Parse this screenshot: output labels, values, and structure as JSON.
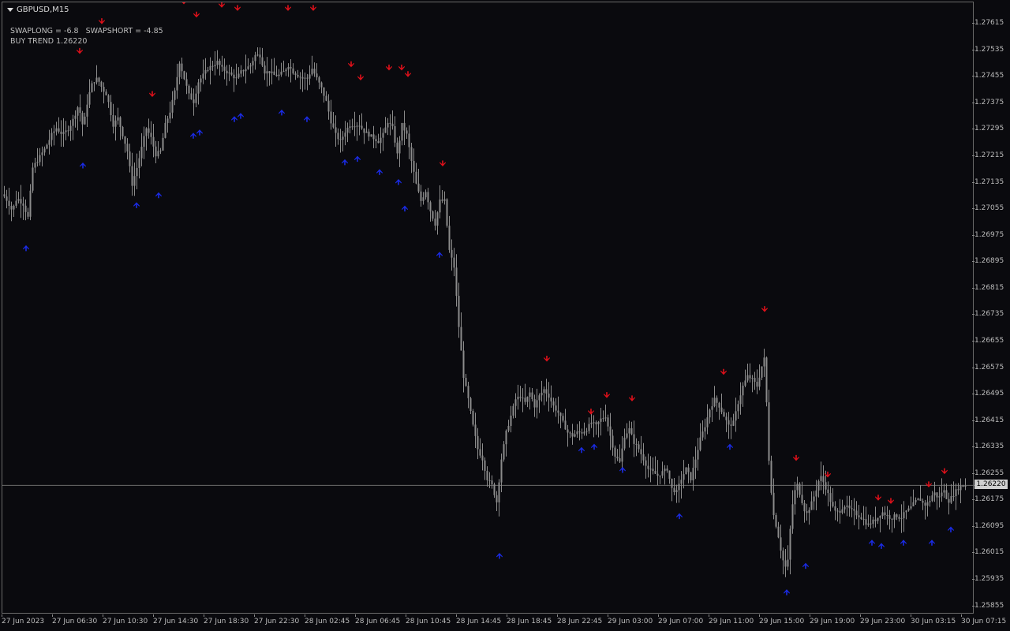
{
  "symbol": {
    "label": "GBPUSD,M15"
  },
  "indicator": {
    "swap_line": "SWAPLONG = -6.8   SWAPSHORT = -4.85",
    "trend_line": "BUY TREND 1.26220"
  },
  "price_axis": {
    "labels": [
      "1.27615",
      "1.27535",
      "1.27455",
      "1.27375",
      "1.27295",
      "1.27215",
      "1.27135",
      "1.27055",
      "1.26975",
      "1.26895",
      "1.26815",
      "1.26735",
      "1.26655",
      "1.26575",
      "1.26495",
      "1.26415",
      "1.26335",
      "1.26255",
      "1.26175",
      "1.26095",
      "1.26015",
      "1.25935",
      "1.25855"
    ]
  },
  "current_price": {
    "label": "1.26220",
    "value": 1.2622
  },
  "time_axis": {
    "labels": [
      "27 Jun 2023",
      "27 Jun 06:30",
      "27 Jun 10:30",
      "27 Jun 14:30",
      "27 Jun 18:30",
      "27 Jun 22:30",
      "28 Jun 02:45",
      "28 Jun 06:45",
      "28 Jun 10:45",
      "28 Jun 14:45",
      "28 Jun 18:45",
      "28 Jun 22:45",
      "29 Jun 03:00",
      "29 Jun 07:00",
      "29 Jun 11:00",
      "29 Jun 15:00",
      "29 Jun 19:00",
      "29 Jun 23:00",
      "30 Jun 03:15",
      "30 Jun 07:15"
    ]
  },
  "colors": {
    "background": "#0a0a0e",
    "candle": "#8c8c8c",
    "sell_arrow": "#e0101a",
    "buy_arrow": "#1a2be6",
    "grid_line": "#6a6a6a"
  },
  "chart_data": {
    "type": "candlestick",
    "symbol": "GBPUSD",
    "timeframe": "M15",
    "y_range": [
      1.2583,
      1.2768
    ],
    "path": [
      [
        0,
        1.271
      ],
      [
        6,
        1.2708
      ],
      [
        12,
        1.2705
      ],
      [
        18,
        1.2709
      ],
      [
        26,
        1.2707
      ],
      [
        32,
        1.2703
      ],
      [
        38,
        1.2718
      ],
      [
        46,
        1.2721
      ],
      [
        54,
        1.2724
      ],
      [
        62,
        1.2728
      ],
      [
        68,
        1.273
      ],
      [
        76,
        1.2728
      ],
      [
        84,
        1.273
      ],
      [
        90,
        1.2733
      ],
      [
        96,
        1.2737
      ],
      [
        102,
        1.273
      ],
      [
        108,
        1.2739
      ],
      [
        114,
        1.2744
      ],
      [
        120,
        1.2745
      ],
      [
        126,
        1.2742
      ],
      [
        132,
        1.274
      ],
      [
        140,
        1.2731
      ],
      [
        146,
        1.2733
      ],
      [
        152,
        1.2728
      ],
      [
        158,
        1.2723
      ],
      [
        164,
        1.2713
      ],
      [
        170,
        1.2718
      ],
      [
        176,
        1.2724
      ],
      [
        182,
        1.273
      ],
      [
        188,
        1.2727
      ],
      [
        194,
        1.2722
      ],
      [
        200,
        1.2723
      ],
      [
        206,
        1.2731
      ],
      [
        212,
        1.2735
      ],
      [
        218,
        1.2741
      ],
      [
        224,
        1.275
      ],
      [
        230,
        1.2745
      ],
      [
        236,
        1.274
      ],
      [
        242,
        1.2738
      ],
      [
        248,
        1.2744
      ],
      [
        254,
        1.2746
      ],
      [
        260,
        1.2748
      ],
      [
        266,
        1.2749
      ],
      [
        272,
        1.275
      ],
      [
        278,
        1.2748
      ],
      [
        284,
        1.2747
      ],
      [
        290,
        1.2746
      ],
      [
        296,
        1.2745
      ],
      [
        302,
        1.2747
      ],
      [
        308,
        1.2748
      ],
      [
        314,
        1.2749
      ],
      [
        320,
        1.2752
      ],
      [
        326,
        1.2752
      ],
      [
        332,
        1.2747
      ],
      [
        338,
        1.2747
      ],
      [
        344,
        1.2746
      ],
      [
        350,
        1.2746
      ],
      [
        356,
        1.2747
      ],
      [
        362,
        1.2749
      ],
      [
        368,
        1.2747
      ],
      [
        374,
        1.2746
      ],
      [
        380,
        1.2745
      ],
      [
        386,
        1.2745
      ],
      [
        392,
        1.2748
      ],
      [
        398,
        1.2745
      ],
      [
        404,
        1.2742
      ],
      [
        410,
        1.2738
      ],
      [
        416,
        1.2732
      ],
      [
        422,
        1.2728
      ],
      [
        428,
        1.2726
      ],
      [
        434,
        1.2729
      ],
      [
        440,
        1.2731
      ],
      [
        446,
        1.2731
      ],
      [
        452,
        1.2731
      ],
      [
        458,
        1.2729
      ],
      [
        464,
        1.2728
      ],
      [
        470,
        1.2727
      ],
      [
        476,
        1.2726
      ],
      [
        482,
        1.2728
      ],
      [
        488,
        1.2732
      ],
      [
        494,
        1.273
      ],
      [
        500,
        1.2722
      ],
      [
        506,
        1.2731
      ],
      [
        512,
        1.2728
      ],
      [
        518,
        1.272
      ],
      [
        524,
        1.2713
      ],
      [
        530,
        1.2708
      ],
      [
        536,
        1.2711
      ],
      [
        542,
        1.2705
      ],
      [
        548,
        1.2701
      ],
      [
        554,
        1.2708
      ],
      [
        560,
        1.2708
      ],
      [
        566,
        1.2693
      ],
      [
        572,
        1.2688
      ],
      [
        578,
        1.267
      ],
      [
        584,
        1.2655
      ],
      [
        590,
        1.2648
      ],
      [
        596,
        1.264
      ],
      [
        602,
        1.2633
      ],
      [
        608,
        1.263
      ],
      [
        614,
        1.2624
      ],
      [
        620,
        1.2622
      ],
      [
        626,
        1.2617
      ],
      [
        632,
        1.263
      ],
      [
        638,
        1.2638
      ],
      [
        644,
        1.2643
      ],
      [
        650,
        1.2648
      ],
      [
        656,
        1.2649
      ],
      [
        662,
        1.2647
      ],
      [
        668,
        1.265
      ],
      [
        674,
        1.2646
      ],
      [
        680,
        1.2649
      ],
      [
        686,
        1.2651
      ],
      [
        692,
        1.2649
      ],
      [
        698,
        1.2646
      ],
      [
        704,
        1.2644
      ],
      [
        710,
        1.2641
      ],
      [
        716,
        1.2638
      ],
      [
        722,
        1.2637
      ],
      [
        728,
        1.2638
      ],
      [
        734,
        1.2638
      ],
      [
        740,
        1.2639
      ],
      [
        746,
        1.2641
      ],
      [
        752,
        1.264
      ],
      [
        758,
        1.2642
      ],
      [
        764,
        1.2643
      ],
      [
        770,
        1.2637
      ],
      [
        776,
        1.2631
      ],
      [
        782,
        1.2629
      ],
      [
        788,
        1.2637
      ],
      [
        794,
        1.2639
      ],
      [
        800,
        1.2635
      ],
      [
        806,
        1.2633
      ],
      [
        812,
        1.263
      ],
      [
        818,
        1.2627
      ],
      [
        824,
        1.2626
      ],
      [
        830,
        1.2625
      ],
      [
        836,
        1.2626
      ],
      [
        842,
        1.2627
      ],
      [
        848,
        1.2621
      ],
      [
        854,
        1.262
      ],
      [
        860,
        1.2624
      ],
      [
        866,
        1.2627
      ],
      [
        872,
        1.2624
      ],
      [
        878,
        1.263
      ],
      [
        884,
        1.2636
      ],
      [
        890,
        1.264
      ],
      [
        896,
        1.2645
      ],
      [
        902,
        1.2648
      ],
      [
        908,
        1.2646
      ],
      [
        914,
        1.2643
      ],
      [
        920,
        1.264
      ],
      [
        926,
        1.2641
      ],
      [
        932,
        1.2647
      ],
      [
        938,
        1.2652
      ],
      [
        944,
        1.2655
      ],
      [
        950,
        1.2654
      ],
      [
        956,
        1.2652
      ],
      [
        962,
        1.2658
      ],
      [
        966,
        1.2661
      ],
      [
        970,
        1.2633
      ],
      [
        976,
        1.2614
      ],
      [
        982,
        1.2608
      ],
      [
        988,
        1.26
      ],
      [
        994,
        1.2596
      ],
      [
        1000,
        1.2615
      ],
      [
        1006,
        1.2623
      ],
      [
        1012,
        1.2618
      ],
      [
        1018,
        1.2613
      ],
      [
        1024,
        1.2616
      ],
      [
        1030,
        1.262
      ],
      [
        1036,
        1.2625
      ],
      [
        1042,
        1.2622
      ],
      [
        1048,
        1.2618
      ],
      [
        1054,
        1.2614
      ],
      [
        1060,
        1.2614
      ],
      [
        1066,
        1.2616
      ],
      [
        1072,
        1.2615
      ],
      [
        1078,
        1.2614
      ],
      [
        1084,
        1.2613
      ],
      [
        1090,
        1.2612
      ],
      [
        1096,
        1.261
      ],
      [
        1102,
        1.2611
      ],
      [
        1108,
        1.2612
      ],
      [
        1114,
        1.2614
      ],
      [
        1120,
        1.2613
      ],
      [
        1126,
        1.2612
      ],
      [
        1132,
        1.2613
      ],
      [
        1138,
        1.2612
      ],
      [
        1144,
        1.2614
      ],
      [
        1150,
        1.2615
      ],
      [
        1156,
        1.2617
      ],
      [
        1162,
        1.2618
      ],
      [
        1168,
        1.2616
      ],
      [
        1174,
        1.2617
      ],
      [
        1180,
        1.262
      ],
      [
        1186,
        1.2618
      ],
      [
        1192,
        1.2621
      ],
      [
        1198,
        1.2617
      ],
      [
        1204,
        1.2619
      ],
      [
        1210,
        1.2621
      ],
      [
        1216,
        1.2622
      ],
      [
        1222,
        1.2622
      ]
    ],
    "sell_arrows": [
      [
        98,
        1.2753
      ],
      [
        126,
        1.2762
      ],
      [
        190,
        1.274
      ],
      [
        230,
        1.2768
      ],
      [
        246,
        1.2764
      ],
      [
        278,
        1.2767
      ],
      [
        298,
        1.2766
      ],
      [
        326,
        1.277
      ],
      [
        362,
        1.2766
      ],
      [
        394,
        1.2766
      ],
      [
        442,
        1.2749
      ],
      [
        454,
        1.2745
      ],
      [
        490,
        1.2748
      ],
      [
        506,
        1.2748
      ],
      [
        514,
        1.2746
      ],
      [
        558,
        1.2719
      ],
      [
        690,
        1.266
      ],
      [
        746,
        1.2644
      ],
      [
        766,
        1.2649
      ],
      [
        798,
        1.2648
      ],
      [
        914,
        1.2656
      ],
      [
        966,
        1.2675
      ],
      [
        1006,
        1.263
      ],
      [
        1046,
        1.2625
      ],
      [
        1110,
        1.2618
      ],
      [
        1126,
        1.2617
      ],
      [
        1174,
        1.2622
      ],
      [
        1194,
        1.2626
      ]
    ],
    "buy_arrows": [
      [
        30,
        1.2694
      ],
      [
        102,
        1.2719
      ],
      [
        170,
        1.2707
      ],
      [
        198,
        1.271
      ],
      [
        242,
        1.2728
      ],
      [
        250,
        1.2729
      ],
      [
        294,
        1.2733
      ],
      [
        302,
        1.2734
      ],
      [
        354,
        1.2735
      ],
      [
        386,
        1.2733
      ],
      [
        434,
        1.272
      ],
      [
        450,
        1.2721
      ],
      [
        478,
        1.2717
      ],
      [
        502,
        1.2714
      ],
      [
        510,
        1.2706
      ],
      [
        554,
        1.2692
      ],
      [
        630,
        1.2601
      ],
      [
        734,
        1.2633
      ],
      [
        750,
        1.2634
      ],
      [
        786,
        1.2627
      ],
      [
        858,
        1.2613
      ],
      [
        922,
        1.2634
      ],
      [
        994,
        1.259
      ],
      [
        1018,
        1.2598
      ],
      [
        1102,
        1.2605
      ],
      [
        1114,
        1.2604
      ],
      [
        1142,
        1.2605
      ],
      [
        1178,
        1.2605
      ],
      [
        1202,
        1.2609
      ]
    ]
  }
}
